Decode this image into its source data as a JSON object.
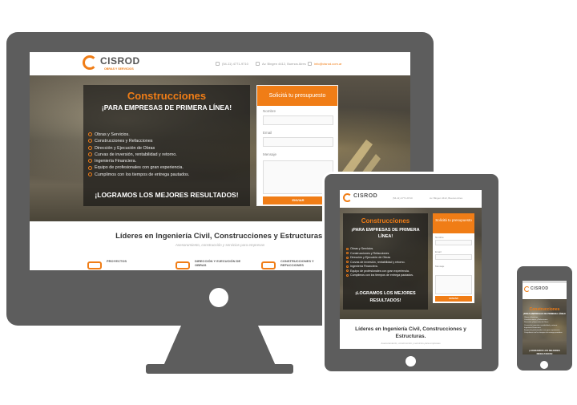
{
  "site": {
    "logo": {
      "name": "CISROD",
      "tagline": "OBRAS Y SERVICIOS"
    },
    "contact": {
      "phone": "(54-11) 4771-9710",
      "address": "Av. Bingen 4412, Buenos Aires",
      "email": "info@cisrod.com.ar"
    },
    "hero": {
      "title": "Construcciones",
      "subtitle": "¡PARA EMPRESAS DE PRIMERA LÍNEA!",
      "items": [
        "Obras y Servicios.",
        "Construcciones y Refacciones",
        "Dirección y Ejecución de Obras",
        "Curvas de inversión, rentabilidad y retorno.",
        "Ingeniería Financiera.",
        "Equipo de profesionales con gran experiencia.",
        "Cumplimos con los tiempos de entrega pautados."
      ],
      "slogan": "¡LOGRAMOS LOS MEJORES RESULTADOS!"
    },
    "form": {
      "title": "Solicitá tu presupuesto",
      "fields": [
        "Nombre",
        "Email",
        "Mensaje"
      ],
      "submit": "ENVIAR"
    },
    "lead": {
      "title": "Líderes en Ingeniería Civil, Construcciones y Estructuras.",
      "subtitle": "Asesoramiento, construcción y servicios para empresas"
    },
    "services": [
      "PROYECTOS",
      "DIRECCIÓN Y EJECUCIÓN DE OBRAS",
      "CONSTRUCCIONES Y REFACCIONES"
    ]
  },
  "colors": {
    "accent": "#f07d16",
    "device": "#5d5d5d",
    "overlay": "#0f0f0f"
  }
}
